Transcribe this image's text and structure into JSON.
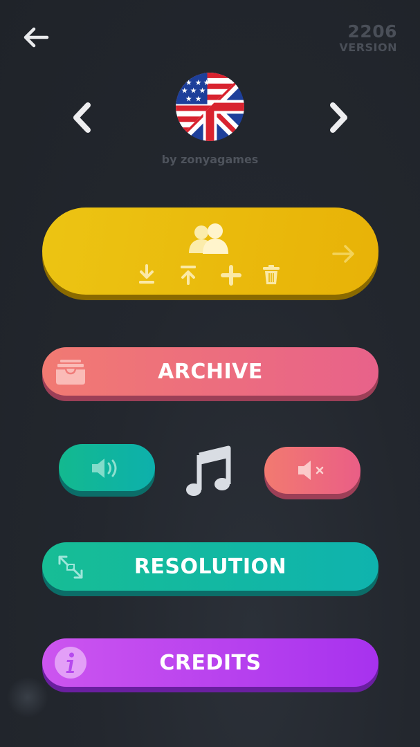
{
  "header": {
    "version_number": "2206",
    "version_label": "VERSION"
  },
  "language": {
    "flag_icon": "us-uk-flag-icon",
    "author": "by zonyagames"
  },
  "menu": {
    "players": {
      "icons": [
        "users-icon",
        "download-icon",
        "upload-icon",
        "plus-icon",
        "trash-icon",
        "arrow-right-icon"
      ]
    },
    "archive": {
      "label": "ARCHIVE",
      "icon": "archive-box-icon"
    },
    "sound": {
      "on_icon": "speaker-on-icon",
      "music_icon": "music-note-icon",
      "off_icon": "speaker-mute-icon"
    },
    "resolution": {
      "label": "RESOLUTION",
      "icon": "resize-icon"
    },
    "credits": {
      "label": "CREDITS",
      "icon": "info-icon"
    }
  },
  "colors": {
    "background": "#23272e",
    "yellow": "#ecc413",
    "coral": "#f17a72",
    "teal": "#17bd95",
    "purple": "#b63ff0"
  }
}
